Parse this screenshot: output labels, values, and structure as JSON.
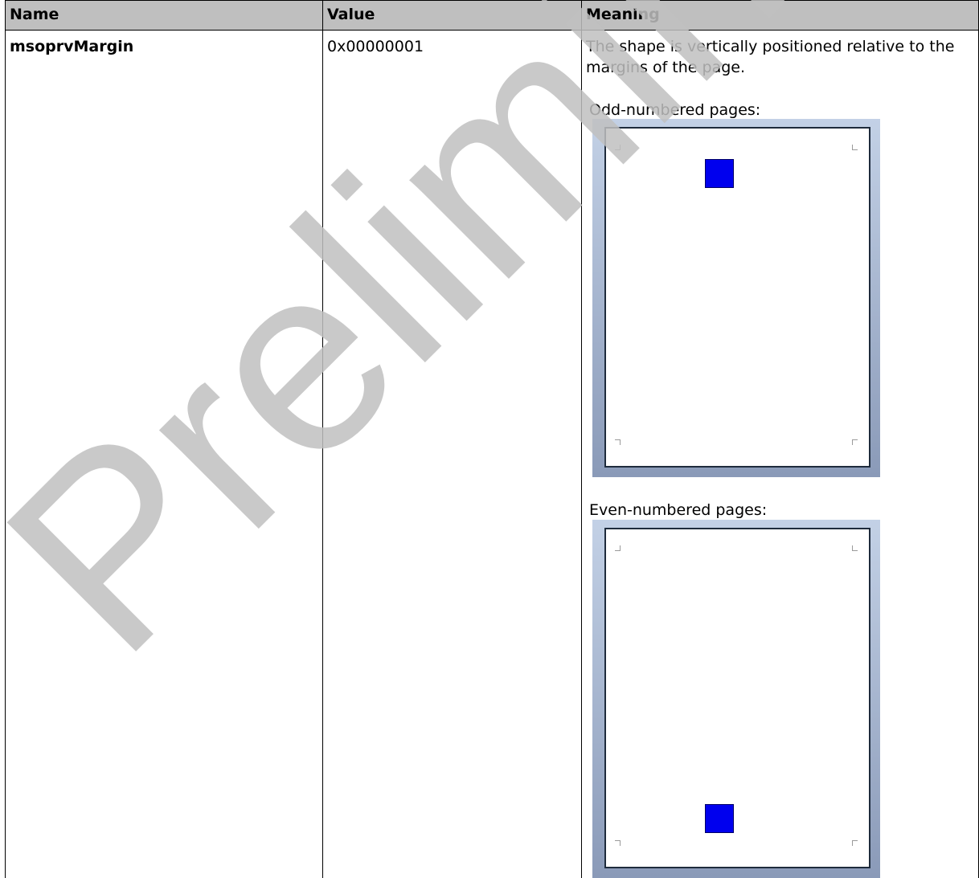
{
  "table": {
    "headers": [
      "Name",
      "Value",
      "Meaning"
    ],
    "row": {
      "name": "msoprvMargin",
      "value": "0x00000001",
      "description": "The shape is vertically positioned relative to the margins of the page.",
      "odd_label": "Odd-numbered pages:",
      "even_label": "Even-numbered pages:"
    }
  },
  "figures": {
    "shape_color": "#0000EE",
    "odd_shape_position": "top",
    "even_shape_position": "bottom"
  },
  "watermark": {
    "text": "Preliminary",
    "color": "#c0c0c0"
  }
}
